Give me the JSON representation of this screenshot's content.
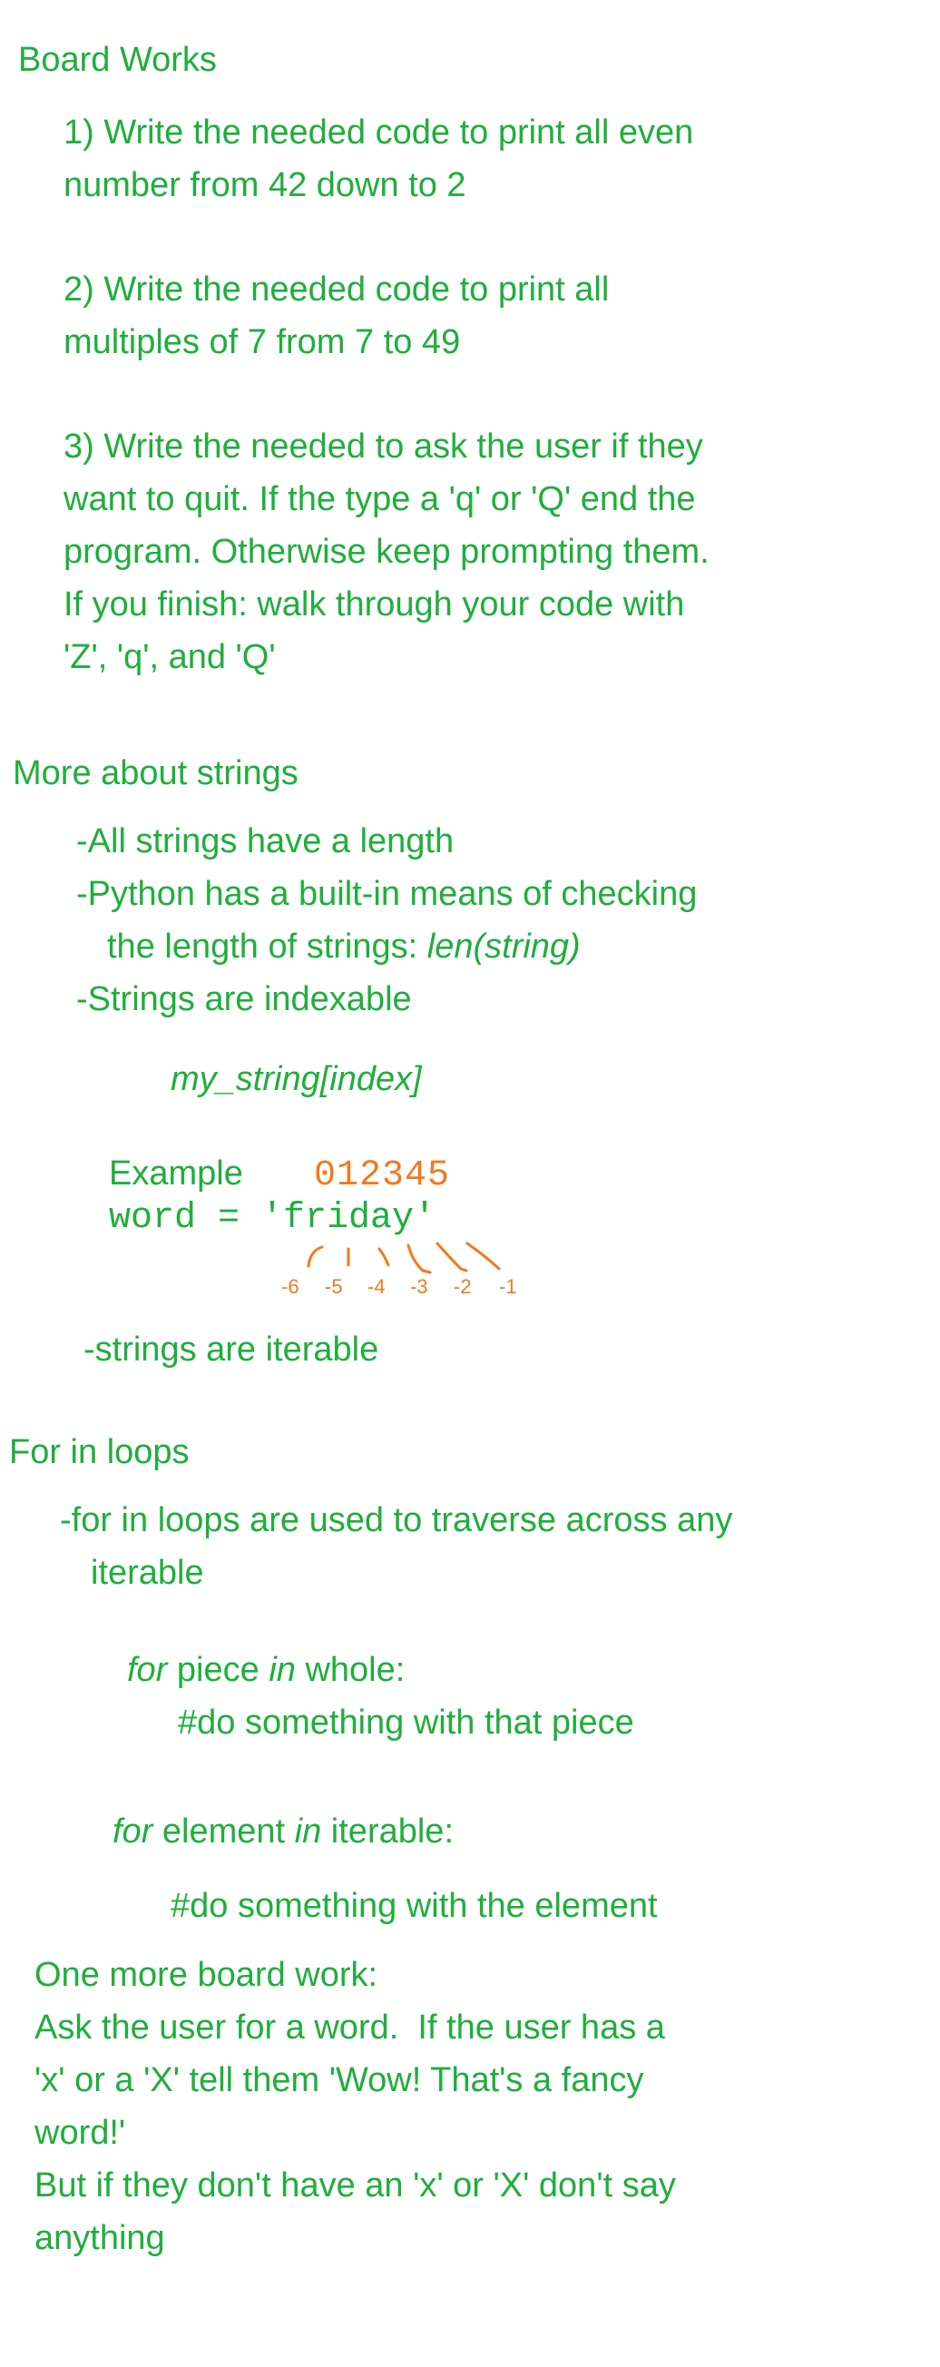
{
  "board_works": {
    "heading": "Board Works",
    "q1": [
      "1) Write the needed code to print all even",
      "number from 42 down to 2"
    ],
    "q2": [
      "2) Write the needed code to print all",
      "multiples of 7 from 7 to 49"
    ],
    "q3": [
      "3) Write the needed to ask the user if they",
      "want to quit. If the type a 'q' or 'Q' end the",
      "program. Otherwise keep prompting them.",
      "If you finish: walk through your code with",
      "'Z', 'q', and 'Q'"
    ]
  },
  "strings": {
    "heading": "More about strings",
    "bullet1": "-All strings have a length",
    "bullet2_a": "-Python has a built-in means of checking",
    "bullet2_b_prefix": "the length of strings: ",
    "bullet2_b_code": "len(string)",
    "bullet3": "-Strings are indexable",
    "index_syntax": "my_string[index]",
    "example_label": "Example",
    "positive_indices": "012345",
    "example_code": "word = 'friday'",
    "negative_indices": [
      "-6",
      "-5",
      "-4",
      "-3",
      "-2",
      "-1"
    ],
    "bullet4": "-strings are iterable"
  },
  "for_loops": {
    "heading": "For in loops",
    "desc_a": "-for in loops are used to traverse across any",
    "desc_b": "iterable",
    "ex1": {
      "kw_for": "for",
      "var": " piece ",
      "kw_in": "in",
      "rest": " whole:",
      "body": "#do something with that piece"
    },
    "ex2": {
      "kw_for": "for",
      "var": " element ",
      "kw_in": "in",
      "rest": " iterable:",
      "body": "#do something with the element"
    }
  },
  "extra": {
    "lines": [
      "One more board work:",
      "Ask the user for a word.  If the user has a",
      "'x' or a 'X' tell them 'Wow! That's a fancy",
      "word!'",
      "But if they don't have an 'x' or 'X' don't say",
      "anything"
    ]
  },
  "colors": {
    "ink_green": "#1fae3c",
    "ink_orange": "#f07a1e"
  }
}
